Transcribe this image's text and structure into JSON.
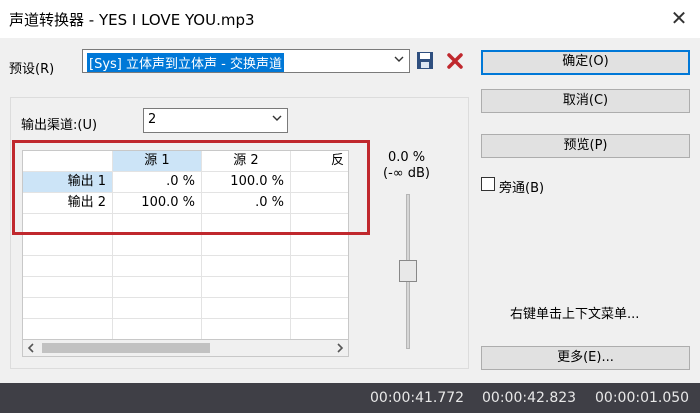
{
  "window": {
    "title": "声道转换器 - YES I LOVE YOU.mp3",
    "close": "✕"
  },
  "preset": {
    "label": "预设(R)",
    "value": "[Sys] 立体声到立体声 - 交换声道"
  },
  "buttons": {
    "ok": "确定(O)",
    "cancel": "取消(C)",
    "preview": "预览(P)",
    "more": "更多(E)..."
  },
  "bypass": {
    "label": "旁通(B)",
    "checked": false
  },
  "output_channels": {
    "label": "输出渠道:(U)",
    "value": "2"
  },
  "grid": {
    "columns": [
      "源 1",
      "源 2",
      "反"
    ],
    "rows": [
      {
        "label": "输出 1",
        "cells": [
          ".0 %",
          "100.0 %",
          ""
        ]
      },
      {
        "label": "输出 2",
        "cells": [
          "100.0 %",
          ".0 %",
          ""
        ]
      }
    ]
  },
  "slider": {
    "percent": "0.0 %",
    "db": "(-∞ dB)"
  },
  "hint": "右键单击上下文菜单...",
  "status": {
    "t1": "00:00:41.772",
    "t2": "00:00:42.823",
    "t3": "00:00:01.050"
  },
  "colors": {
    "accent": "#0078d7",
    "highlight": "#c0282d",
    "delete_icon": "#c0282d",
    "save_icon": "#2f4f7f"
  }
}
